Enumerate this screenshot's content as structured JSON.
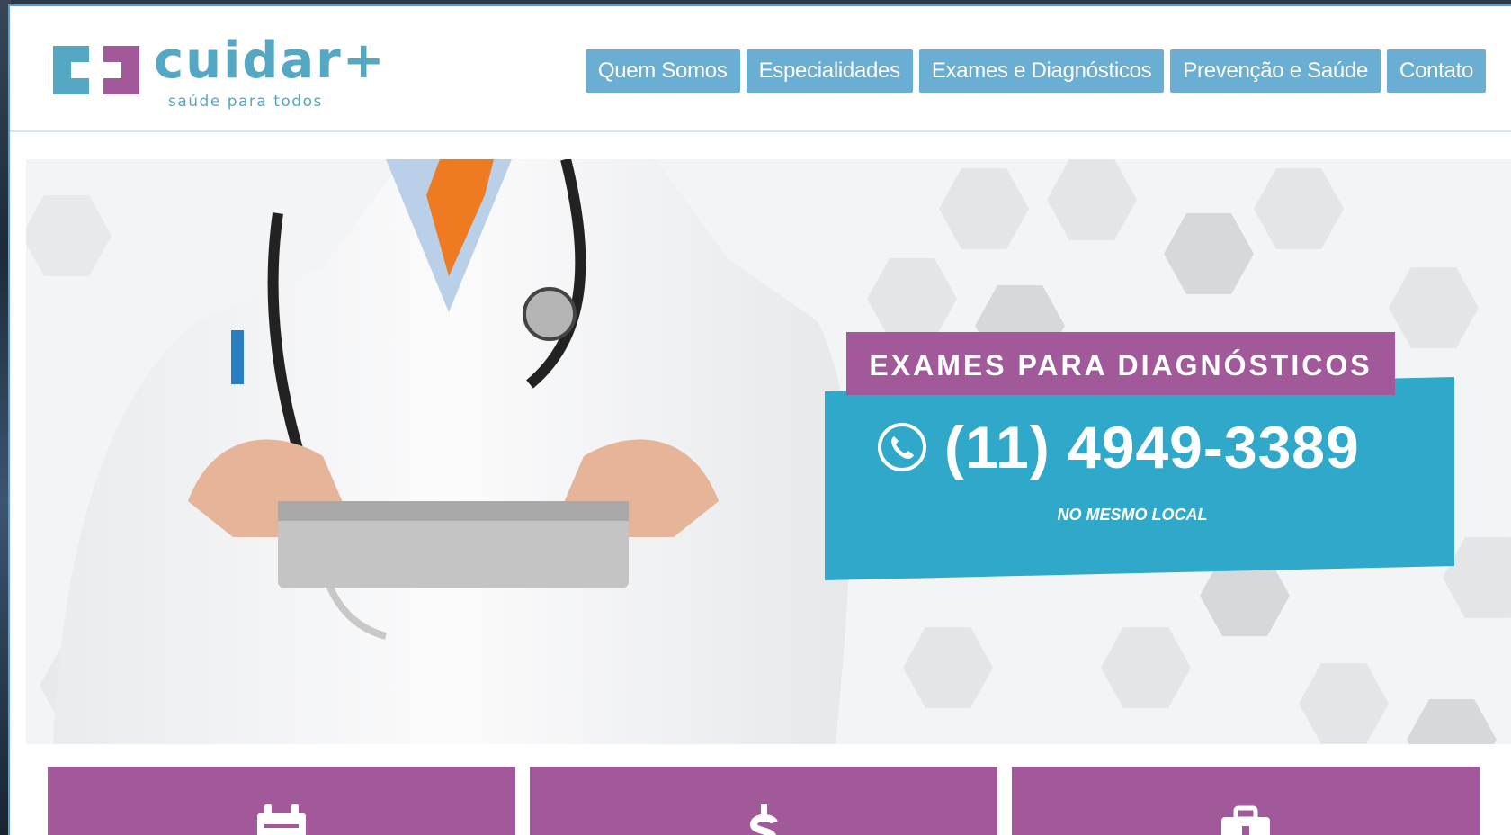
{
  "brand": {
    "name": "cuidar+",
    "tagline": "saúde para todos",
    "colors": {
      "blue": "#55a8c4",
      "purple": "#a2599a",
      "nav": "#6aaed3",
      "teal": "#2fa8c9"
    }
  },
  "nav": {
    "items": [
      {
        "label": "Quem Somos"
      },
      {
        "label": "Especialidades"
      },
      {
        "label": "Exames e Diagnósticos"
      },
      {
        "label": "Prevenção e Saúde"
      },
      {
        "label": "Contato"
      }
    ]
  },
  "hero": {
    "title": "EXAMES PARA DIAGNÓSTICOS",
    "phone": "(11) 4949-3389",
    "subtitle": "NO MESMO LOCAL",
    "phone_icon": "phone-icon"
  },
  "cards": [
    {
      "icon": "calendar-icon"
    },
    {
      "icon": "dollar-icon"
    },
    {
      "icon": "briefcase-icon"
    }
  ]
}
